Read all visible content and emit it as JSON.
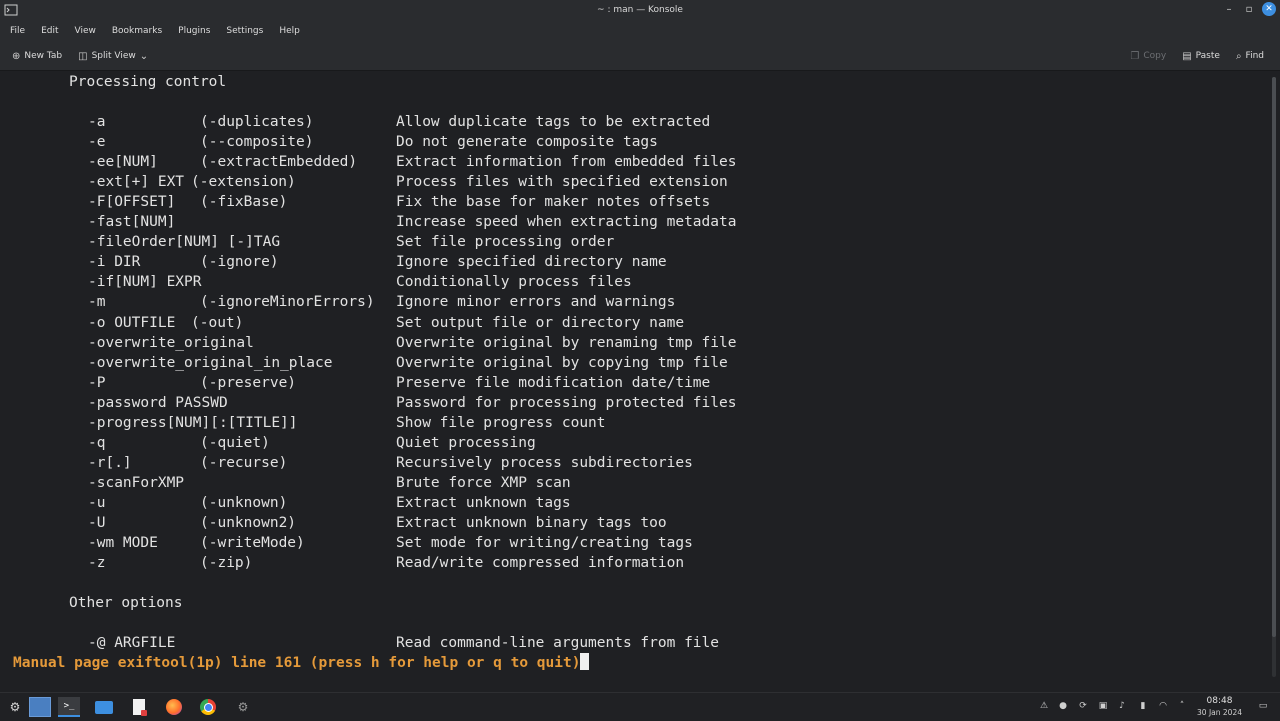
{
  "window": {
    "title": "~ : man — Konsole"
  },
  "menu": [
    "File",
    "Edit",
    "View",
    "Bookmarks",
    "Plugins",
    "Settings",
    "Help"
  ],
  "toolbar": {
    "new_tab": "New Tab",
    "split_view": "Split View",
    "copy": "Copy",
    "paste": "Paste",
    "find": "Find"
  },
  "terminal": {
    "section1": "Processing control",
    "options": [
      {
        "opt": "-a",
        "long": "(-duplicates)",
        "desc": "Allow duplicate tags to be extracted"
      },
      {
        "opt": "-e",
        "long": "(--composite)",
        "desc": "Do not generate composite tags"
      },
      {
        "opt": "-ee[NUM]",
        "long": "(-extractEmbedded)",
        "desc": "Extract information from embedded files"
      },
      {
        "opt": "-ext[+] EXT",
        "long": "(-extension)",
        "desc": "Process files with specified extension",
        "shift": true
      },
      {
        "opt": "-F[OFFSET]",
        "long": "(-fixBase)",
        "desc": "Fix the base for maker notes offsets"
      },
      {
        "opt": "-fast[NUM]",
        "long": "",
        "desc": "Increase speed when extracting metadata"
      },
      {
        "opt": "-fileOrder[NUM] [-]TAG",
        "long": "",
        "desc": "Set file processing order"
      },
      {
        "opt": "-i DIR",
        "long": "(-ignore)",
        "desc": "Ignore specified directory name"
      },
      {
        "opt": "-if[NUM] EXPR",
        "long": "",
        "desc": "Conditionally process files"
      },
      {
        "opt": "-m",
        "long": "(-ignoreMinorErrors)",
        "desc": "Ignore minor errors and warnings"
      },
      {
        "opt": "-o OUTFILE",
        "long": "(-out)",
        "desc": "Set output file or directory name",
        "shift": true
      },
      {
        "opt": "-overwrite_original",
        "long": "",
        "desc": "Overwrite original by renaming tmp file"
      },
      {
        "opt": "-overwrite_original_in_place",
        "long": "",
        "desc": "Overwrite original by copying tmp file"
      },
      {
        "opt": "-P",
        "long": "(-preserve)",
        "desc": "Preserve file modification date/time"
      },
      {
        "opt": "-password PASSWD",
        "long": "",
        "desc": "Password for processing protected files"
      },
      {
        "opt": "-progress[NUM][:[TITLE]]",
        "long": "",
        "desc": "Show file progress count"
      },
      {
        "opt": "-q",
        "long": "(-quiet)",
        "desc": "Quiet processing"
      },
      {
        "opt": "-r[.]",
        "long": "(-recurse)",
        "desc": "Recursively process subdirectories"
      },
      {
        "opt": "-scanForXMP",
        "long": "",
        "desc": "Brute force XMP scan"
      },
      {
        "opt": "-u",
        "long": "(-unknown)",
        "desc": "Extract unknown tags"
      },
      {
        "opt": "-U",
        "long": "(-unknown2)",
        "desc": "Extract unknown binary tags too"
      },
      {
        "opt": "-wm MODE",
        "long": "(-writeMode)",
        "desc": "Set mode for writing/creating tags"
      },
      {
        "opt": "-z",
        "long": "(-zip)",
        "desc": "Read/write compressed information"
      }
    ],
    "section2": "Other options",
    "other_options": [
      {
        "opt": "-@ ARGFILE",
        "long": "",
        "desc": "Read command-line arguments from file"
      }
    ],
    "status": "Manual page exiftool(1p) line 161 (press h for help or q to quit)"
  },
  "taskbar": {
    "time": "08:48",
    "date": "30 Jan 2024"
  },
  "colors": {
    "background": "#1f2023",
    "status_text": "#e59a3a",
    "accent": "#3d8fe0"
  }
}
